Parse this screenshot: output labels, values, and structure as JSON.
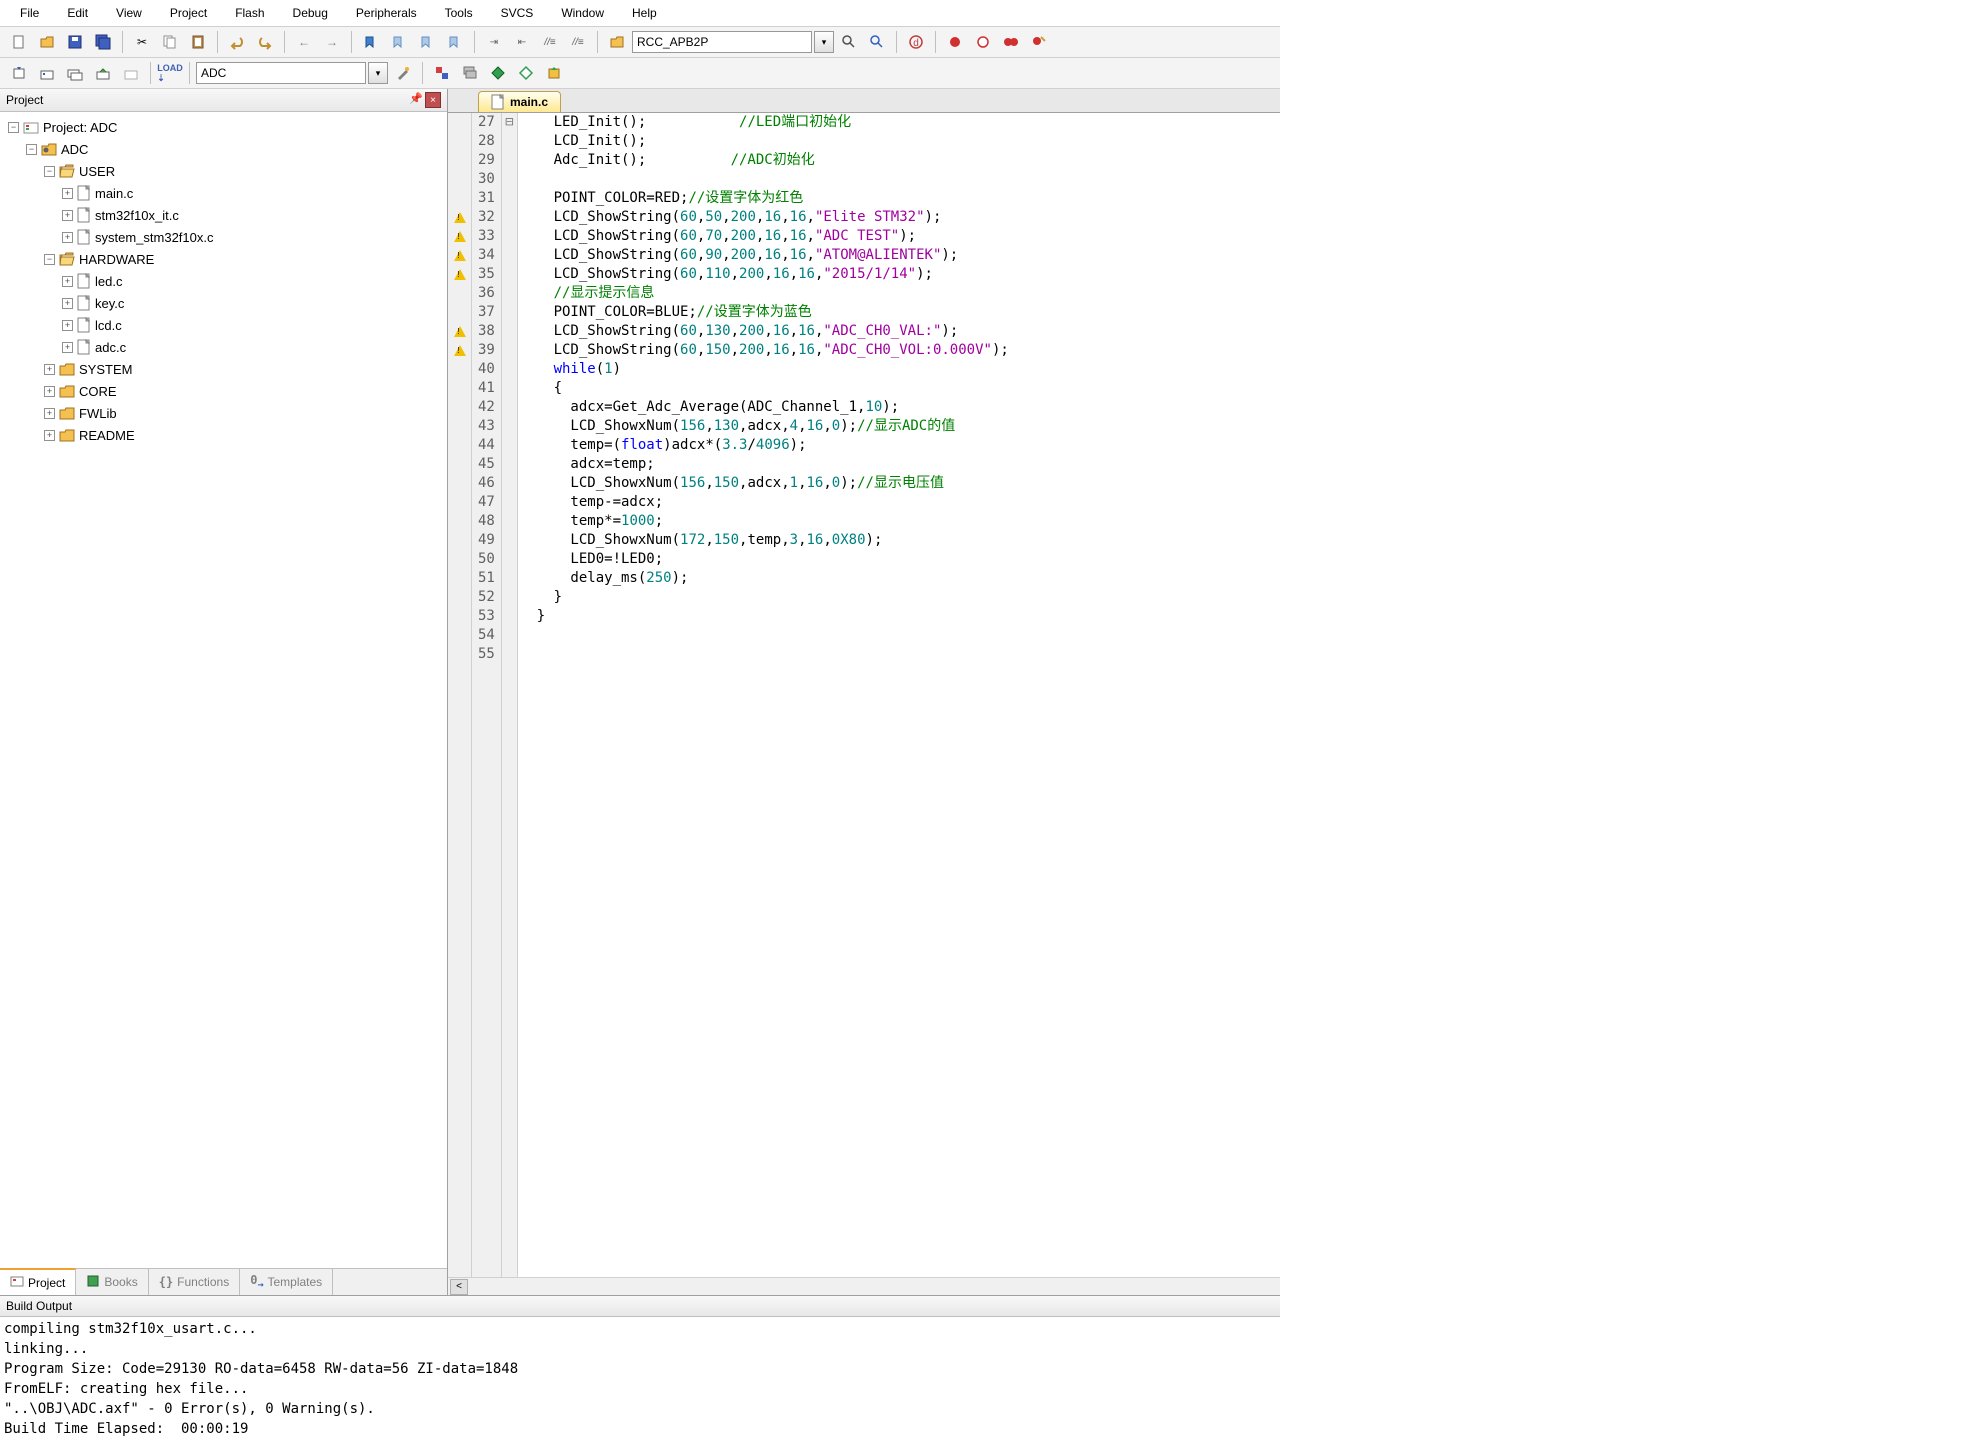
{
  "menu": [
    "File",
    "Edit",
    "View",
    "Project",
    "Flash",
    "Debug",
    "Peripherals",
    "Tools",
    "SVCS",
    "Window",
    "Help"
  ],
  "toolbar_target": "RCC_APB2P",
  "toolbar2_sel": "ADC",
  "project_panel_title": "Project",
  "tree": {
    "root": "Project: ADC",
    "target": "ADC",
    "groups": [
      {
        "name": "USER",
        "open": true,
        "files": [
          "main.c",
          "stm32f10x_it.c",
          "system_stm32f10x.c"
        ]
      },
      {
        "name": "HARDWARE",
        "open": true,
        "files": [
          "led.c",
          "key.c",
          "lcd.c",
          "adc.c"
        ]
      },
      {
        "name": "SYSTEM",
        "open": false,
        "files": []
      },
      {
        "name": "CORE",
        "open": false,
        "files": []
      },
      {
        "name": "FWLib",
        "open": false,
        "files": []
      },
      {
        "name": "README",
        "open": false,
        "files": []
      }
    ]
  },
  "left_tabs": [
    "Project",
    "Books",
    "Functions",
    "Templates"
  ],
  "editor_tab": "main.c",
  "code_start_line": 27,
  "code_lines": [
    {
      "warn": false,
      "fold": "",
      "html": "    LED_Init();           <span class='c-cmt'>//LED端口初始化</span>"
    },
    {
      "warn": false,
      "fold": "",
      "html": "    LCD_Init();"
    },
    {
      "warn": false,
      "fold": "",
      "html": "    Adc_Init();          <span class='c-cmt'>//ADC初始化</span>"
    },
    {
      "warn": false,
      "fold": "",
      "html": ""
    },
    {
      "warn": false,
      "fold": "",
      "html": "    POINT_COLOR=RED;<span class='c-cmt'>//设置字体为红色</span>"
    },
    {
      "warn": true,
      "fold": "",
      "html": "    LCD_ShowString(<span class='c-num'>60</span>,<span class='c-num'>50</span>,<span class='c-num'>200</span>,<span class='c-num'>16</span>,<span class='c-num'>16</span>,<span class='c-str'>\"Elite STM32\"</span>);"
    },
    {
      "warn": true,
      "fold": "",
      "html": "    LCD_ShowString(<span class='c-num'>60</span>,<span class='c-num'>70</span>,<span class='c-num'>200</span>,<span class='c-num'>16</span>,<span class='c-num'>16</span>,<span class='c-str'>\"ADC TEST\"</span>);"
    },
    {
      "warn": true,
      "fold": "",
      "html": "    LCD_ShowString(<span class='c-num'>60</span>,<span class='c-num'>90</span>,<span class='c-num'>200</span>,<span class='c-num'>16</span>,<span class='c-num'>16</span>,<span class='c-str'>\"ATOM@ALIENTEK\"</span>);"
    },
    {
      "warn": true,
      "fold": "",
      "html": "    LCD_ShowString(<span class='c-num'>60</span>,<span class='c-num'>110</span>,<span class='c-num'>200</span>,<span class='c-num'>16</span>,<span class='c-num'>16</span>,<span class='c-str'>\"2015/1/14\"</span>);"
    },
    {
      "warn": false,
      "fold": "",
      "html": "    <span class='c-cmt'>//显示提示信息</span>"
    },
    {
      "warn": false,
      "fold": "",
      "html": "    POINT_COLOR=BLUE;<span class='c-cmt'>//设置字体为蓝色</span>"
    },
    {
      "warn": true,
      "fold": "",
      "html": "    LCD_ShowString(<span class='c-num'>60</span>,<span class='c-num'>130</span>,<span class='c-num'>200</span>,<span class='c-num'>16</span>,<span class='c-num'>16</span>,<span class='c-str'>\"ADC_CH0_VAL:\"</span>);"
    },
    {
      "warn": true,
      "fold": "",
      "html": "    LCD_ShowString(<span class='c-num'>60</span>,<span class='c-num'>150</span>,<span class='c-num'>200</span>,<span class='c-num'>16</span>,<span class='c-num'>16</span>,<span class='c-str'>\"ADC_CH0_VOL:0.000V\"</span>);"
    },
    {
      "warn": false,
      "fold": "",
      "html": "    <span class='c-kw'>while</span>(<span class='c-num'>1</span>)"
    },
    {
      "warn": false,
      "fold": "⊟",
      "html": "    {"
    },
    {
      "warn": false,
      "fold": "",
      "html": "      adcx=Get_Adc_Average(ADC_Channel_1,<span class='c-num'>10</span>);"
    },
    {
      "warn": false,
      "fold": "",
      "html": "      LCD_ShowxNum(<span class='c-num'>156</span>,<span class='c-num'>130</span>,adcx,<span class='c-num'>4</span>,<span class='c-num'>16</span>,<span class='c-num'>0</span>);<span class='c-cmt'>//显示ADC的值</span>"
    },
    {
      "warn": false,
      "fold": "",
      "html": "      temp=(<span class='c-kw'>float</span>)adcx*(<span class='c-num'>3.3</span>/<span class='c-num'>4096</span>);"
    },
    {
      "warn": false,
      "fold": "",
      "html": "      adcx=temp;"
    },
    {
      "warn": false,
      "fold": "",
      "html": "      LCD_ShowxNum(<span class='c-num'>156</span>,<span class='c-num'>150</span>,adcx,<span class='c-num'>1</span>,<span class='c-num'>16</span>,<span class='c-num'>0</span>);<span class='c-cmt'>//显示电压值</span>"
    },
    {
      "warn": false,
      "fold": "",
      "html": "      temp-=adcx;"
    },
    {
      "warn": false,
      "fold": "",
      "html": "      temp*=<span class='c-num'>1000</span>;"
    },
    {
      "warn": false,
      "fold": "",
      "html": "      LCD_ShowxNum(<span class='c-num'>172</span>,<span class='c-num'>150</span>,temp,<span class='c-num'>3</span>,<span class='c-num'>16</span>,<span class='c-num'>0X80</span>);"
    },
    {
      "warn": false,
      "fold": "",
      "html": "      LED0=!LED0;"
    },
    {
      "warn": false,
      "fold": "",
      "html": "      delay_ms(<span class='c-num'>250</span>);"
    },
    {
      "warn": false,
      "fold": "",
      "html": "    }"
    },
    {
      "warn": false,
      "fold": "",
      "html": "  }"
    },
    {
      "warn": false,
      "fold": "",
      "html": ""
    },
    {
      "warn": false,
      "fold": "",
      "html": ""
    }
  ],
  "build_output_title": "Build Output",
  "build_output": "compiling stm32f10x_usart.c...\nlinking...\nProgram Size: Code=29130 RO-data=6458 RW-data=56 ZI-data=1848\nFromELF: creating hex file...\n\"..\\OBJ\\ADC.axf\" - 0 Error(s), 0 Warning(s).\nBuild Time Elapsed:  00:00:19"
}
